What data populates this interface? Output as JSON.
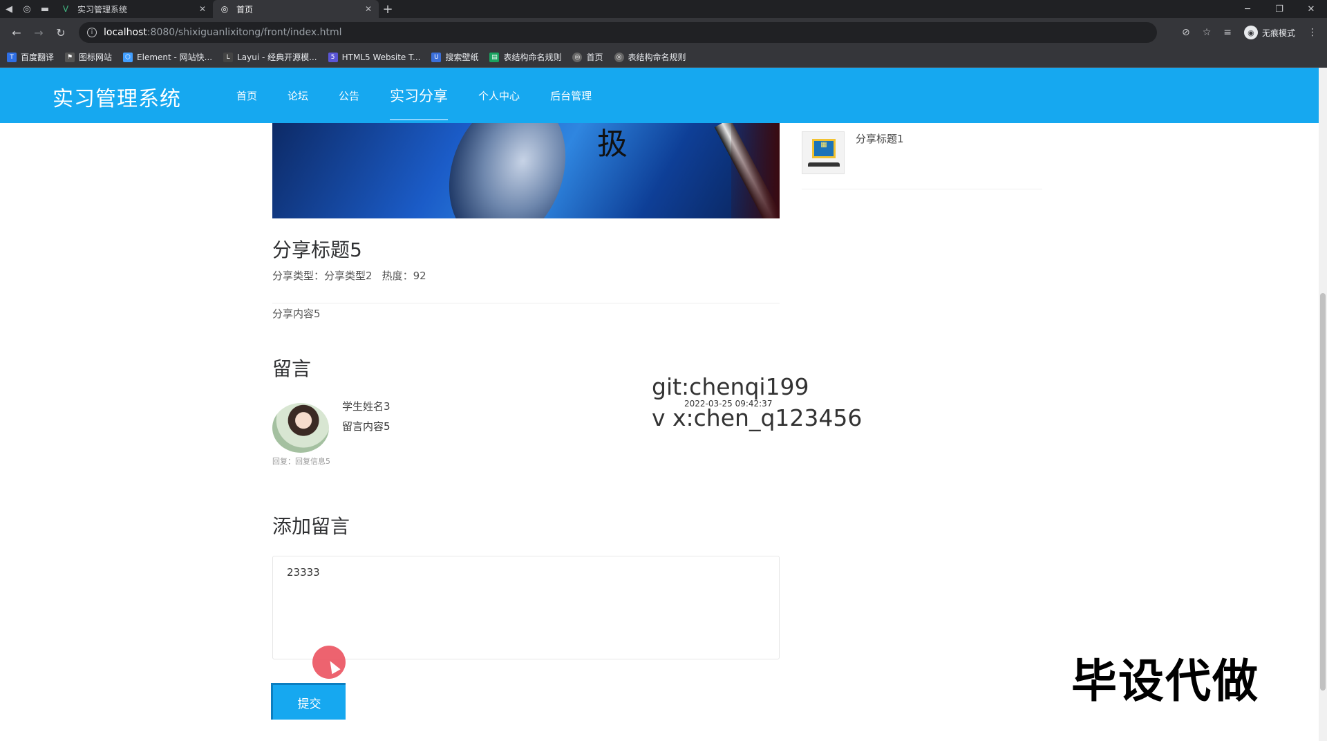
{
  "browser": {
    "tabs": [
      {
        "title": "实习管理系统",
        "active": false
      },
      {
        "title": "首页",
        "active": true
      }
    ],
    "url_host": "localhost",
    "url_path": ":8080/shixiguanlixitong/front/index.html",
    "incognito_label": "无痕模式",
    "bookmarks": [
      {
        "label": "百度翻译",
        "color": "#2f6fe4"
      },
      {
        "label": "图标网站",
        "color": "#555555"
      },
      {
        "label": "Element - 网站快...",
        "color": "#409eff"
      },
      {
        "label": "Layui - 经典开源模...",
        "color": "#444444"
      },
      {
        "label": "HTML5 Website T...",
        "color": "#5a55d6"
      },
      {
        "label": "搜索壁纸",
        "color": "#3b6fd8"
      },
      {
        "label": "表结构命名规则",
        "color": "#1aa260"
      },
      {
        "label": "首页",
        "color": "#666666"
      },
      {
        "label": "表结构命名规则",
        "color": "#666666"
      }
    ]
  },
  "site": {
    "logo": "实习管理系统",
    "nav": [
      {
        "label": "首页",
        "active": false
      },
      {
        "label": "论坛",
        "active": false
      },
      {
        "label": "公告",
        "active": false
      },
      {
        "label": "实习分享",
        "active": true
      },
      {
        "label": "个人中心",
        "active": false
      },
      {
        "label": "后台管理",
        "active": false
      }
    ],
    "accent_color": "#16a8f0"
  },
  "detail": {
    "title": "分享标题5",
    "type_label": "分享类型：",
    "type_value": "分享类型2",
    "heat_label": "热度：",
    "heat_value": "92",
    "content": "分享内容5"
  },
  "messages": {
    "section_title": "留言",
    "items": [
      {
        "name": "学生姓名3",
        "content": "留言内容5",
        "time": "2022-03-25 09:42:37",
        "reply": "回复：回复信息5"
      }
    ]
  },
  "add_message": {
    "section_title": "添加留言",
    "textarea_value": "23333",
    "submit_label": "提交"
  },
  "related": {
    "items": [
      {
        "title": "分享标题1"
      }
    ]
  },
  "overlay": {
    "git": "git:chenqi199",
    "vx": "v x:chen_q123456",
    "big": "毕设代做"
  }
}
